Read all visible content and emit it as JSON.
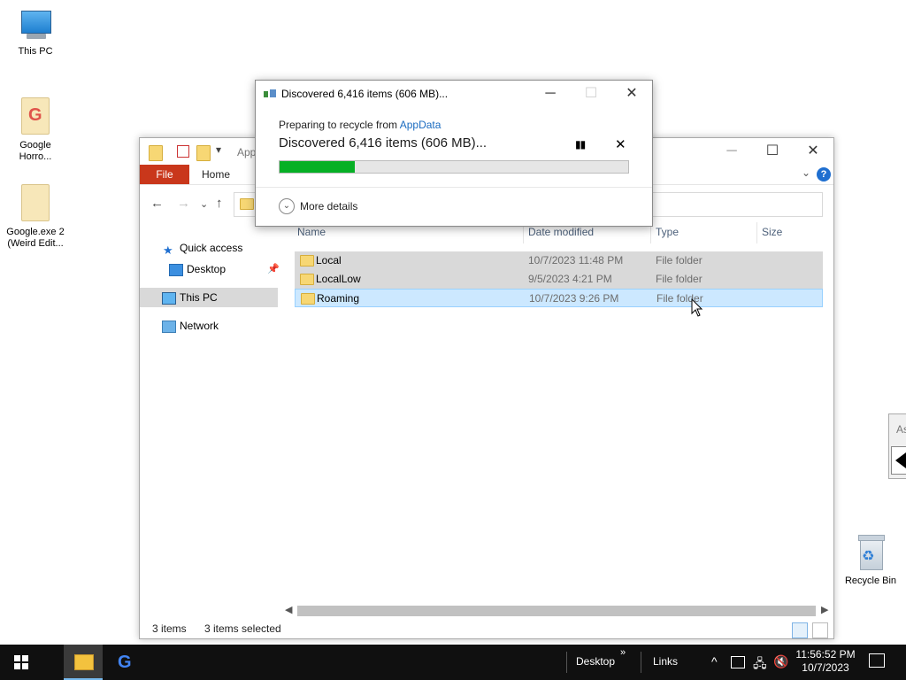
{
  "desktop": {
    "icons": [
      {
        "label": "This PC",
        "icon": "computer-icon"
      },
      {
        "label": "Google Horro...",
        "icon": "file-icon"
      },
      {
        "label": "Google.exe 2 (Weird Edit...",
        "icon": "file-icon"
      },
      {
        "label": "Recycle Bin",
        "icon": "recycle-bin-icon"
      }
    ]
  },
  "explorer": {
    "title_partial": "App",
    "ribbon": {
      "file_tab": "File",
      "home_tab": "Home"
    },
    "nav": {
      "quick_access": "Quick access",
      "desktop": "Desktop",
      "this_pc": "This PC",
      "network": "Network"
    },
    "columns": {
      "name": "Name",
      "date": "Date modified",
      "type": "Type",
      "size": "Size"
    },
    "rows": [
      {
        "name": "Local",
        "date": "10/7/2023 11:48 PM",
        "type": "File folder"
      },
      {
        "name": "LocalLow",
        "date": "9/5/2023 4:21 PM",
        "type": "File folder"
      },
      {
        "name": "Roaming",
        "date": "10/7/2023 9:26 PM",
        "type": "File folder"
      }
    ],
    "status": {
      "items": "3 items",
      "selected": "3 items selected"
    }
  },
  "dialog": {
    "title": "Discovered 6,416 items (606 MB)...",
    "preparing_prefix": "Preparing to recycle from",
    "source_link": "AppData",
    "discovered": "Discovered 6,416 items (606 MB)...",
    "progress": 0.215,
    "more_details": "More details",
    "progress_color": "#06b025"
  },
  "taskbar": {
    "desktop_toolbar": "Desktop",
    "links_toolbar": "Links",
    "chevron": "»",
    "time": "11:56:52 PM",
    "date": "10/7/2023"
  },
  "partial_window": {
    "text": "As"
  }
}
